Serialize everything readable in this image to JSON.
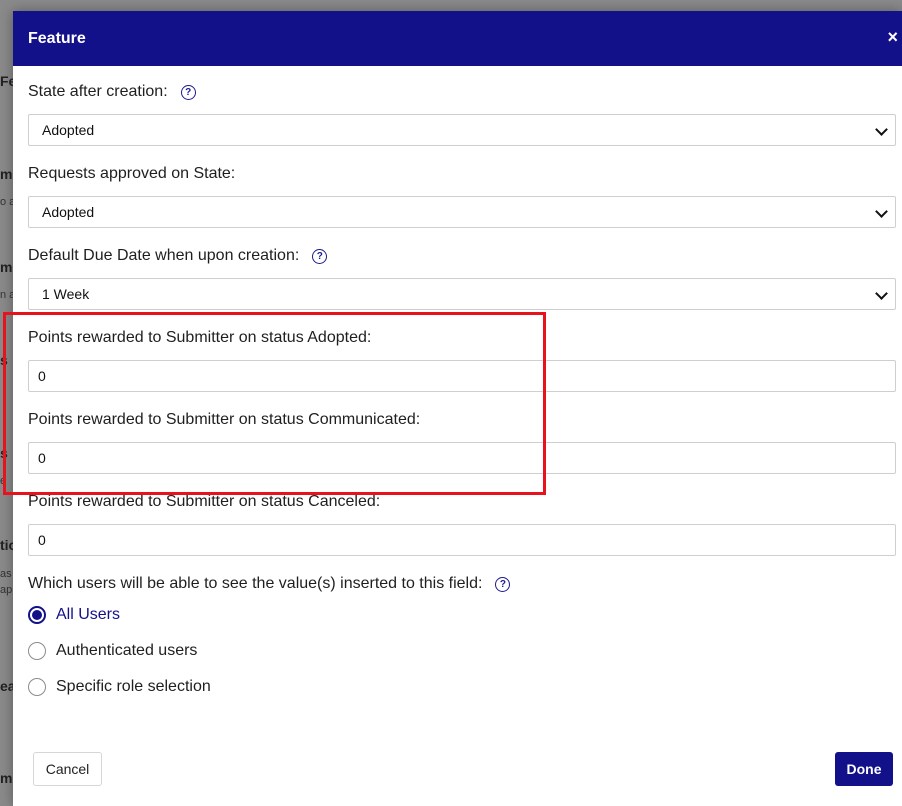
{
  "background": {
    "fragments": [
      "Fe",
      "m",
      "o a",
      "m",
      "n a",
      "s",
      "s",
      "e",
      "tio",
      "as",
      "app",
      "ea",
      "m"
    ]
  },
  "modal": {
    "title": "Feature",
    "close_icon": "×",
    "fields": [
      {
        "label": "State after creation:",
        "has_help": true,
        "type": "select",
        "value": "Adopted"
      },
      {
        "label": "Requests approved on State:",
        "has_help": false,
        "type": "select",
        "value": "Adopted"
      },
      {
        "label": "Default Due Date when upon creation:",
        "has_help": true,
        "type": "select",
        "value": "1 Week"
      },
      {
        "label": "Points rewarded to Submitter on status Adopted:",
        "has_help": false,
        "type": "text",
        "value": "0"
      },
      {
        "label": "Points rewarded to Submitter on status Communicated:",
        "has_help": false,
        "type": "text",
        "value": "0"
      },
      {
        "label": "Points rewarded to Submitter on status Canceled:",
        "has_help": false,
        "type": "text",
        "value": "0"
      }
    ],
    "visibility": {
      "label": "Which users will be able to see the value(s) inserted to this field:",
      "options": [
        {
          "label": "All Users",
          "checked": true
        },
        {
          "label": "Authenticated users",
          "checked": false
        },
        {
          "label": "Specific role selection",
          "checked": false
        }
      ]
    },
    "buttons": {
      "cancel": "Cancel",
      "done": "Done"
    },
    "help_glyph": "?"
  },
  "colors": {
    "header": "#13118a",
    "accent": "#13118a",
    "highlight": "#e8121c"
  }
}
